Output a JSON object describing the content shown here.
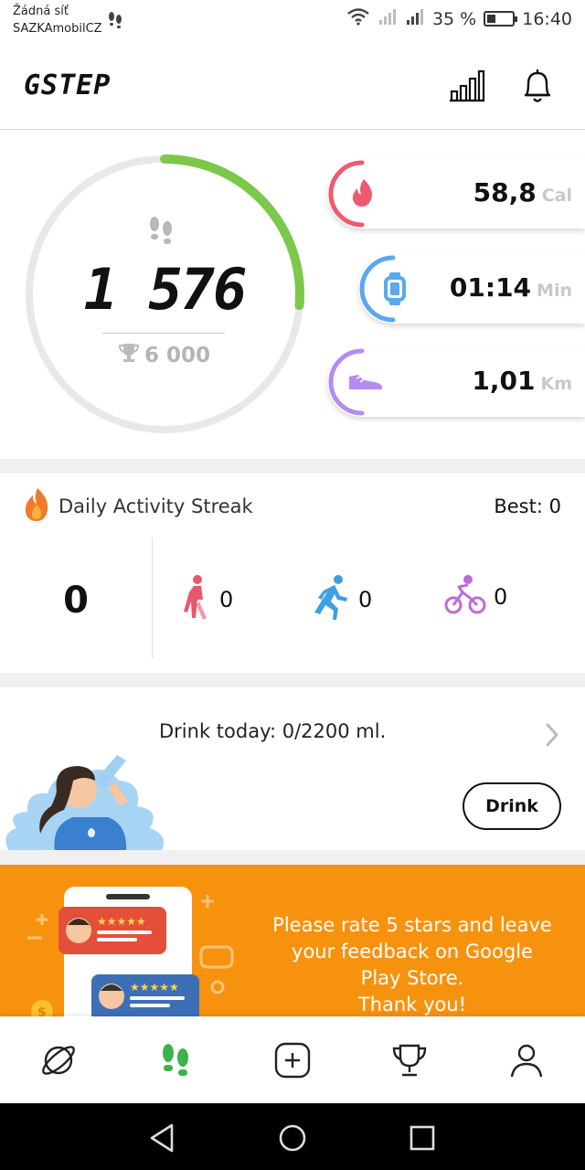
{
  "status_bar": {
    "network_line1": "Žádná síť",
    "network_line2": "SAZKAmobilCZ",
    "battery_text": "35 %",
    "battery_level": 0.35,
    "time": "16:40"
  },
  "header": {
    "logo": "GSTEP",
    "stats_icon": "bar-chart-icon",
    "notifications_icon": "bell-icon"
  },
  "steps": {
    "count": "1 576",
    "goal": "6 000",
    "progress_fraction": 0.263,
    "ring_color": "#7cc84a"
  },
  "metrics": [
    {
      "name": "calories",
      "value": "58,8",
      "unit": "Cal",
      "icon": "flame-icon",
      "color": "#ef5a6f"
    },
    {
      "name": "duration",
      "value": "01:14",
      "unit": "Min",
      "icon": "watch-icon",
      "color": "#5aa8f0"
    },
    {
      "name": "distance",
      "value": "1,01",
      "unit": "Km",
      "icon": "shoe-icon",
      "color": "#b48cf0"
    }
  ],
  "streak": {
    "title": "Daily Activity Streak",
    "best_label": "Best",
    "best_value": "0",
    "current": "0",
    "walking": "0",
    "running": "0",
    "cycling": "0"
  },
  "drink": {
    "label": "Drink today",
    "amount": "0/2200 ml.",
    "button_label": "Drink"
  },
  "promo": {
    "line1": "Please rate 5 stars and leave",
    "line2": "your feedback on Google",
    "line3": "Play Store.",
    "line4": "Thank you!",
    "bg_color": "#f7920f"
  },
  "bottom_nav": {
    "items": [
      "explore-icon",
      "steps-icon",
      "add-icon",
      "trophy-icon",
      "profile-icon"
    ],
    "active": "steps-icon"
  }
}
